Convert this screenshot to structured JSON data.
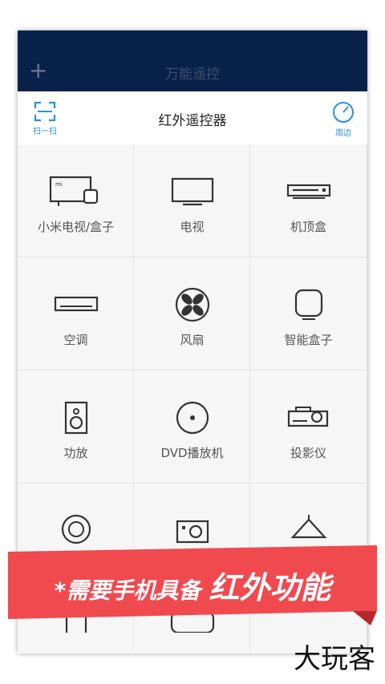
{
  "appbar": {
    "title": "万能遥控",
    "add_icon": "plus-icon"
  },
  "subbar": {
    "title": "红外遥控器",
    "scan_label": "扫一扫",
    "nearby_label": "周边",
    "accent": "#2b8ee0"
  },
  "devices": [
    {
      "label": "小米电视/盒子",
      "icon": "mi-tv-box-icon"
    },
    {
      "label": "电视",
      "icon": "tv-icon"
    },
    {
      "label": "机顶盒",
      "icon": "set-top-box-icon"
    },
    {
      "label": "空调",
      "icon": "air-conditioner-icon"
    },
    {
      "label": "风扇",
      "icon": "fan-icon"
    },
    {
      "label": "智能盒子",
      "icon": "smart-box-icon"
    },
    {
      "label": "功放",
      "icon": "amplifier-icon"
    },
    {
      "label": "DVD播放机",
      "icon": "dvd-icon"
    },
    {
      "label": "投影仪",
      "icon": "projector-icon"
    }
  ],
  "banner": {
    "text_small": "*需要手机具备",
    "text_large": "红外功能",
    "color": "#f04a4f"
  },
  "watermark": "大玩客",
  "colors": {
    "appbar_bg": "#092249",
    "cell_bg": "#f6f6f6"
  }
}
